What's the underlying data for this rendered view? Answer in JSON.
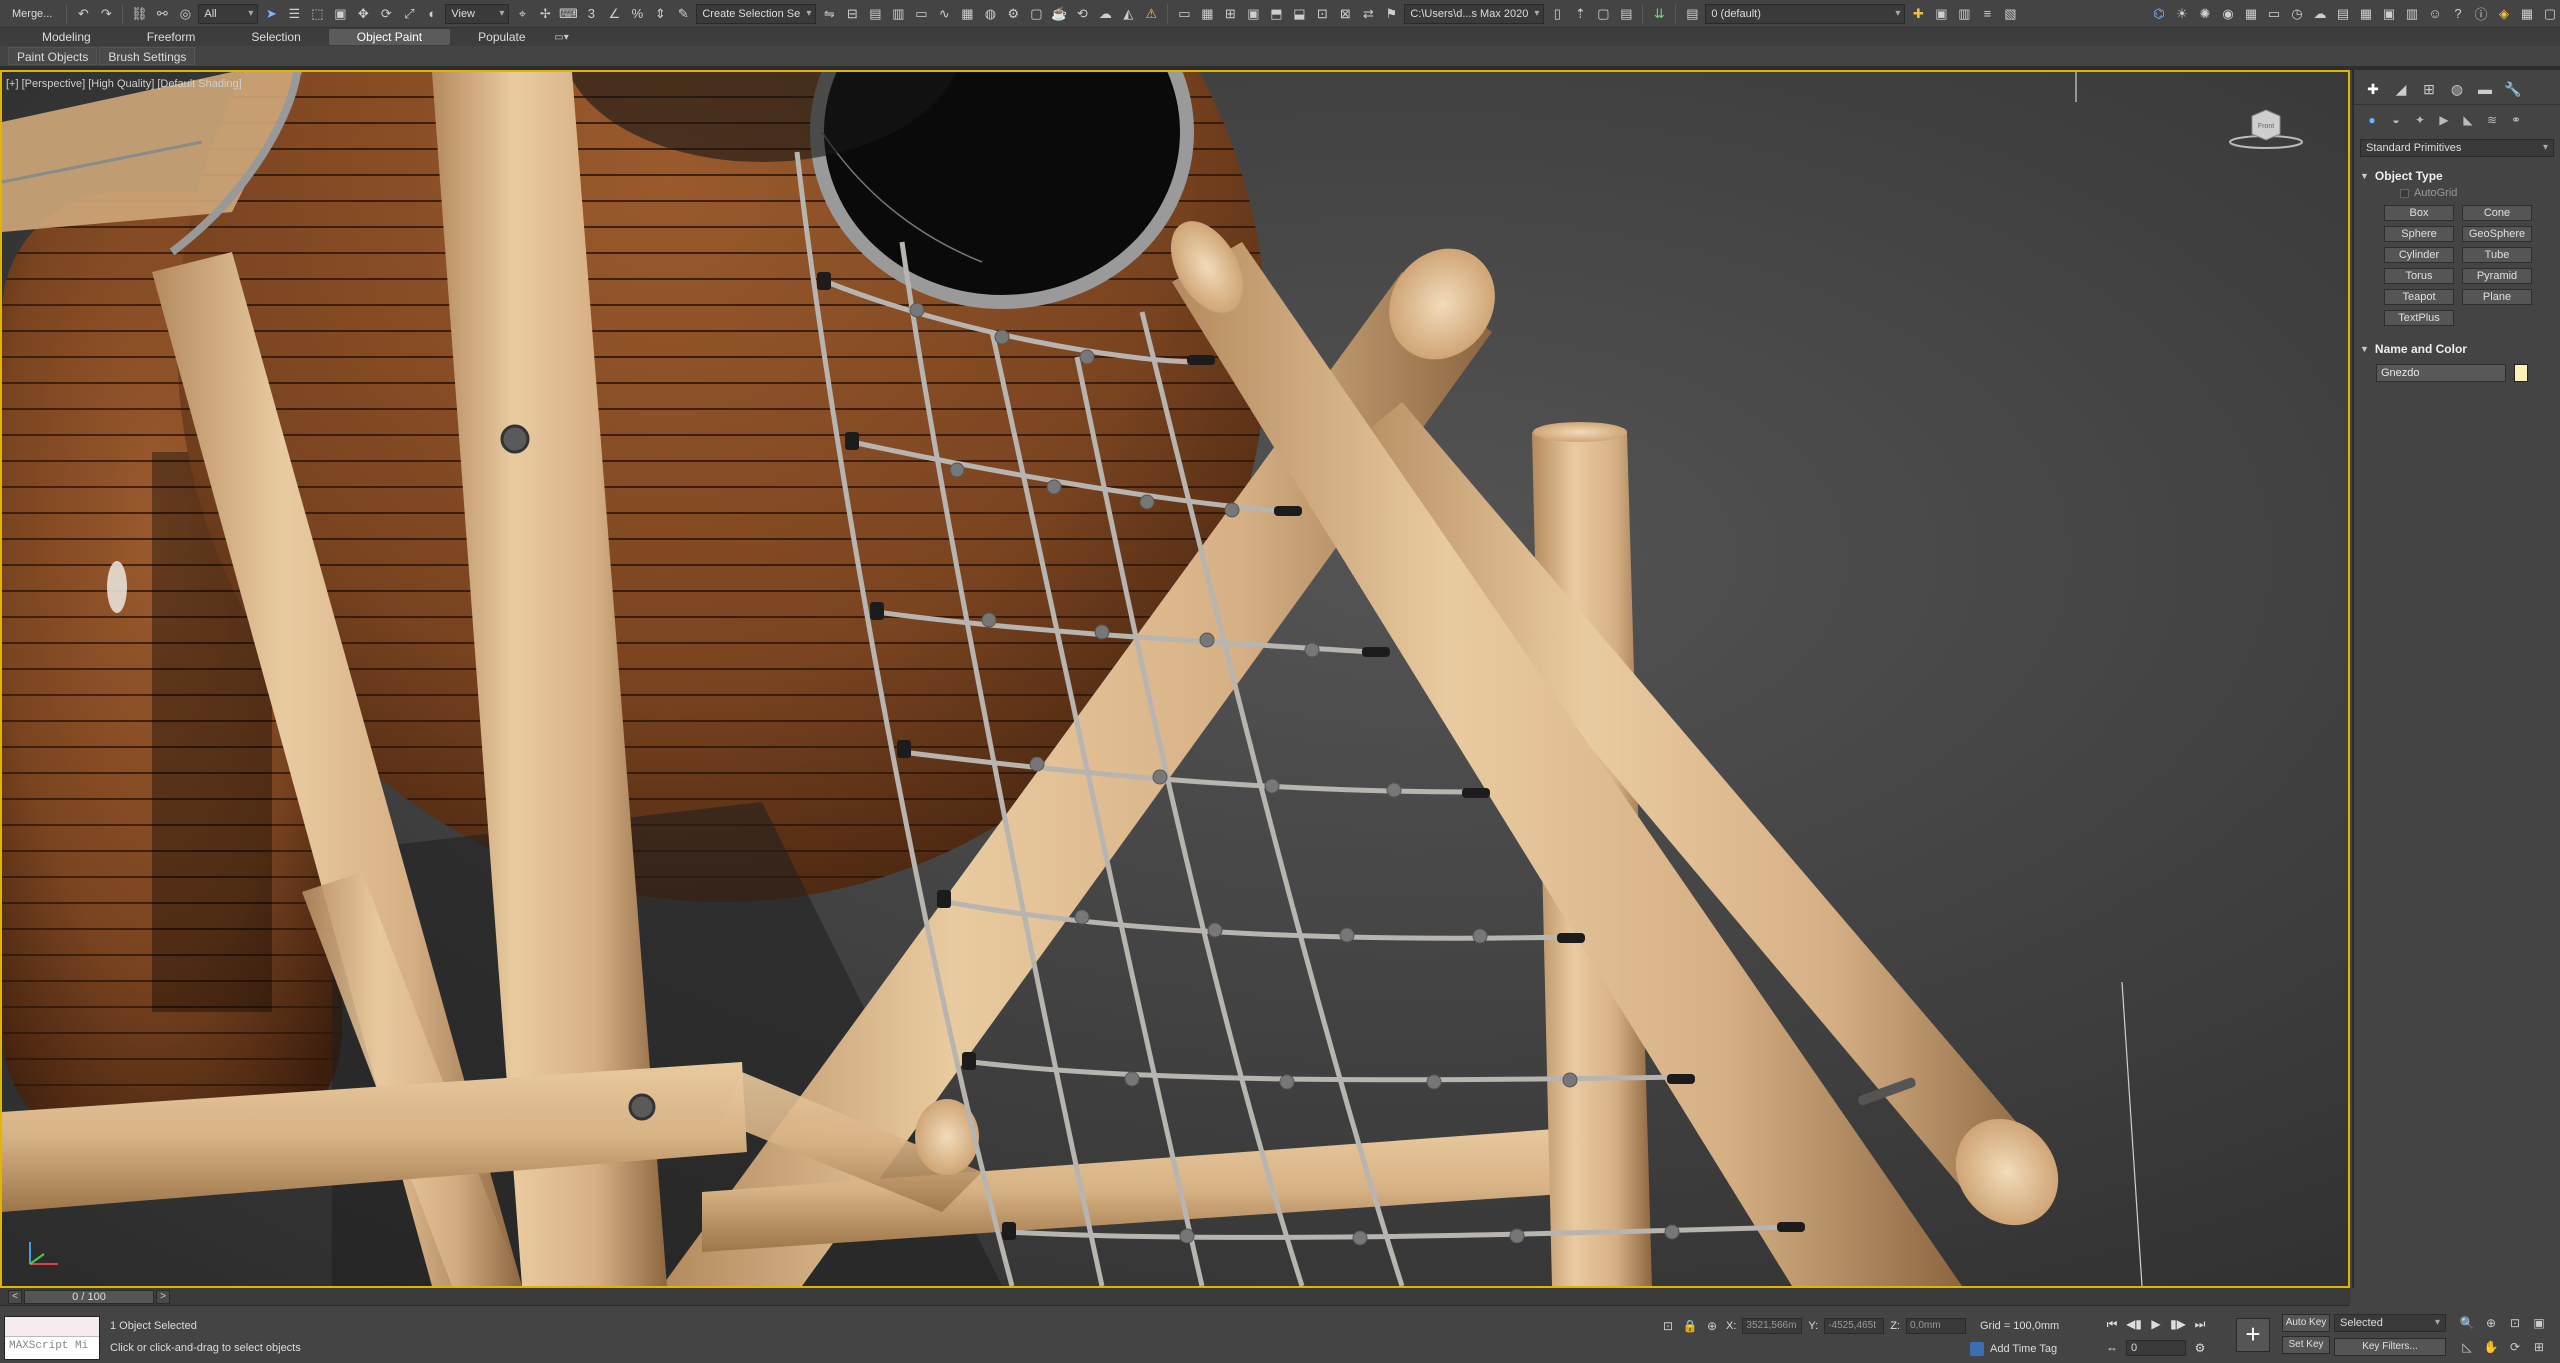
{
  "colors": {
    "viewport_border": "#e0b500",
    "wood": "#d9b486",
    "wood_dark": "#7a4420",
    "rope": "#b8b4b0",
    "swatch": "#fdf1b8",
    "accent_blue": "#7fb6ff"
  },
  "toolbar": {
    "merge_label": "Merge...",
    "filter_value": "All",
    "refcoord_value": "View",
    "named_selection": "Create Selection Se",
    "path_value": "C:\\Users\\d...s Max 2020",
    "layer_value": "0 (default)",
    "icons": [
      "undo-icon",
      "redo-icon",
      "link-icon",
      "unlink-icon",
      "bind-space-warp-icon",
      "select-icon",
      "select-by-name-icon",
      "rect-region-icon",
      "window-crossing-icon",
      "move-icon",
      "rotate-icon",
      "scale-icon",
      "placement-icon",
      "snap-3d-icon",
      "angle-snap-icon",
      "percent-snap-icon",
      "spinner-snap-icon",
      "edit-named-selection-icon",
      "mirror-icon",
      "align-icon",
      "layer-manager-icon",
      "toggle-ribbon-icon",
      "curve-editor-icon",
      "schematic-view-icon",
      "material-editor-icon",
      "render-setup-icon",
      "rendered-frame-window-icon",
      "render-icon",
      "render-iterative-icon",
      "render-cloud-icon",
      "a360-icon",
      "warning-icon"
    ]
  },
  "ribbon": {
    "tabs": [
      "Modeling",
      "Freeform",
      "Selection",
      "Object Paint",
      "Populate"
    ],
    "active_tab": "Object Paint",
    "sub_tabs": [
      "Paint Objects",
      "Brush Settings"
    ]
  },
  "viewport": {
    "label": "[+] [Perspective] [High Quality] [Default Shading]",
    "viewcube_label": "Front"
  },
  "command_panel": {
    "tabs": [
      "create-icon",
      "modify-icon",
      "hierarchy-icon",
      "motion-icon",
      "display-icon",
      "utilities-icon"
    ],
    "sub_categories": [
      "geometry-icon",
      "shapes-icon",
      "lights-icon",
      "cameras-icon",
      "helpers-icon",
      "space-warps-icon",
      "systems-icon"
    ],
    "category_dropdown": "Standard Primitives",
    "object_type_title": "Object Type",
    "autogrid_label": "AutoGrid",
    "primitives": [
      "Box",
      "Cone",
      "Sphere",
      "GeoSphere",
      "Cylinder",
      "Tube",
      "Torus",
      "Pyramid",
      "Teapot",
      "Plane",
      "TextPlus"
    ],
    "name_color_title": "Name and Color",
    "object_name": "Gnezdo"
  },
  "time_slider": {
    "value": "0 / 100",
    "prev": "<",
    "next": ">"
  },
  "status": {
    "maxscript_placeholder": "MAXScript Mi",
    "selection_msg": "1 Object Selected",
    "prompt_msg": "Click or click-and-drag to select objects",
    "x_label": "X:",
    "x_value": "3521,566m",
    "y_label": "Y:",
    "y_value": "-4525,465t",
    "z_label": "Z:",
    "z_value": "0,0mm",
    "grid_text": "Grid = 100,0mm",
    "add_time_tag": "Add Time Tag",
    "frame_value": "0",
    "auto_key": "Auto Key",
    "set_key": "Set Key",
    "key_mode": "Selected",
    "key_filters": "Key Filters..."
  }
}
